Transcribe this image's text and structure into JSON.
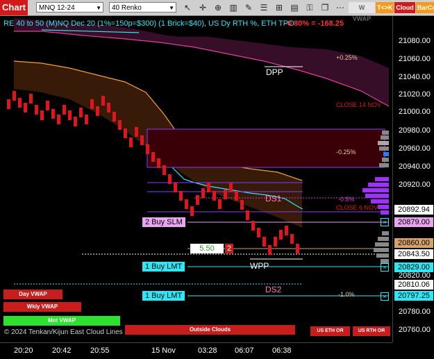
{
  "toolbar": {
    "chart_label": "Chart",
    "instrument": "MNQ 12-24",
    "bar_type": "40 Renko",
    "icons": [
      "pointer-icon",
      "crosshair-icon",
      "zoom-icon",
      "bars-icon",
      "draw-icon",
      "properties-icon",
      "plus-icon",
      "more-icon"
    ],
    "tags": [
      "W VWAP",
      "T<>K",
      "Cloud",
      "BarCo"
    ]
  },
  "title": "RE 40 to 50 (M)NQ Dec 20 (1%=150p=$300) (1 Brick=$40), US Dy RTH %, ETH TPO",
  "percent_change": "-0.80% = -168.25",
  "labels": {
    "dpp": "DPP",
    "ds1": "DS1",
    "wpp": "WPP",
    "ds2": "DS2",
    "pct_plus_025": "+0.25%",
    "pct_minus_025": "-0.25%",
    "pct_minus_05": "-0.5%",
    "pct_minus_10": "-1.0%",
    "close_14nov": "CLOSE 14 NOV",
    "close_6nov": "CLOSE 6 NOV"
  },
  "orders": {
    "buy_slm": "2 Buy SLM",
    "buy_lmt1": "1 Buy LMT",
    "buy_lmt2": "1 Buy LMT",
    "close_x": "×",
    "qty_value": "5.50",
    "qty_count": "2"
  },
  "price_axis": [
    "21080.00",
    "21060.00",
    "21040.00",
    "21020.00",
    "21000.00",
    "20980.00",
    "20960.00",
    "20940.00",
    "20920.00",
    "20900.00",
    "20860.00",
    "20840.00",
    "20820.00",
    "20800.00",
    "20780.00",
    "20760.00"
  ],
  "price_boxes": {
    "p1": "20892.94",
    "p2": "20879.00",
    "p3": "20843.50",
    "p4": "20829.00",
    "p5": "20810.06",
    "p6": "20797.25"
  },
  "bottom_pills": {
    "day_vwap": "Day VWAP",
    "wkly_vwap": "Wkly VWAP",
    "mnt_vwap": "Mnt VWAP",
    "outside_clouds": "Outside Clouds",
    "us_eth_or": "US ETH OR",
    "us_rth_or": "US RTH OR"
  },
  "copyright": "© 2024 Tenkan/Kijun East Cloud Lines",
  "time_axis": [
    "20:20",
    "20:42",
    "20:55",
    "15 Nov",
    "03:28",
    "06:07",
    "06:38"
  ],
  "colors": {
    "accent_cyan": "#2ee7f5",
    "bear_brick": "#e0161c",
    "magenta_cloud": "#3a0f2a",
    "brown_cloud": "#3a1c08",
    "buy_button": "#2ee7f5",
    "slm_button": "#e9a5f0"
  }
}
